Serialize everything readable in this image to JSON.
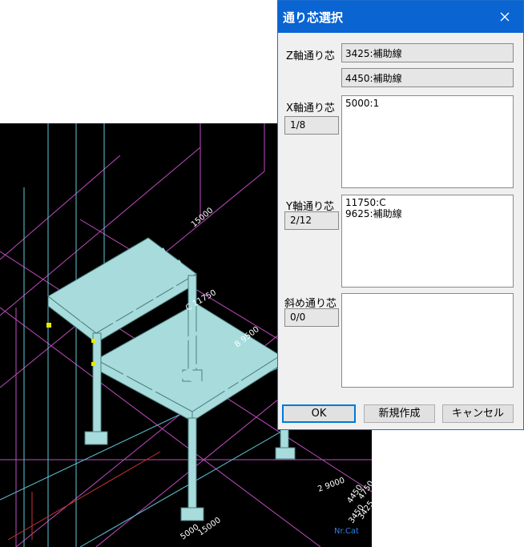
{
  "dialog": {
    "title": "通り芯選択",
    "z_axis": {
      "label": "Z軸通り芯",
      "values": [
        "3425:補助線",
        "4450:補助線"
      ]
    },
    "x_axis": {
      "label": "X軸通り芯",
      "counter": "1/8",
      "items": [
        "5000:1"
      ]
    },
    "y_axis": {
      "label": "Y軸通り芯",
      "counter": "2/12",
      "items": [
        "11750:C",
        "9625:補助線"
      ]
    },
    "oblique": {
      "label": "斜め通り芯",
      "counter": "0/0",
      "items": []
    },
    "buttons": {
      "ok": "OK",
      "new": "新規作成",
      "cancel": "キャンセル"
    }
  },
  "viewport": {
    "labels": [
      "15000",
      "C 11750",
      "B 9500",
      "2 9000",
      "4450",
      "4750",
      "3450",
      "3425",
      "5000",
      "15000",
      "Nr.Cat"
    ]
  },
  "colors": {
    "title_bar": "#0a64d2",
    "structure": "#a8dcdc",
    "grid_magenta": "#c04cc0",
    "grid_cyan": "#5fc7d7"
  }
}
